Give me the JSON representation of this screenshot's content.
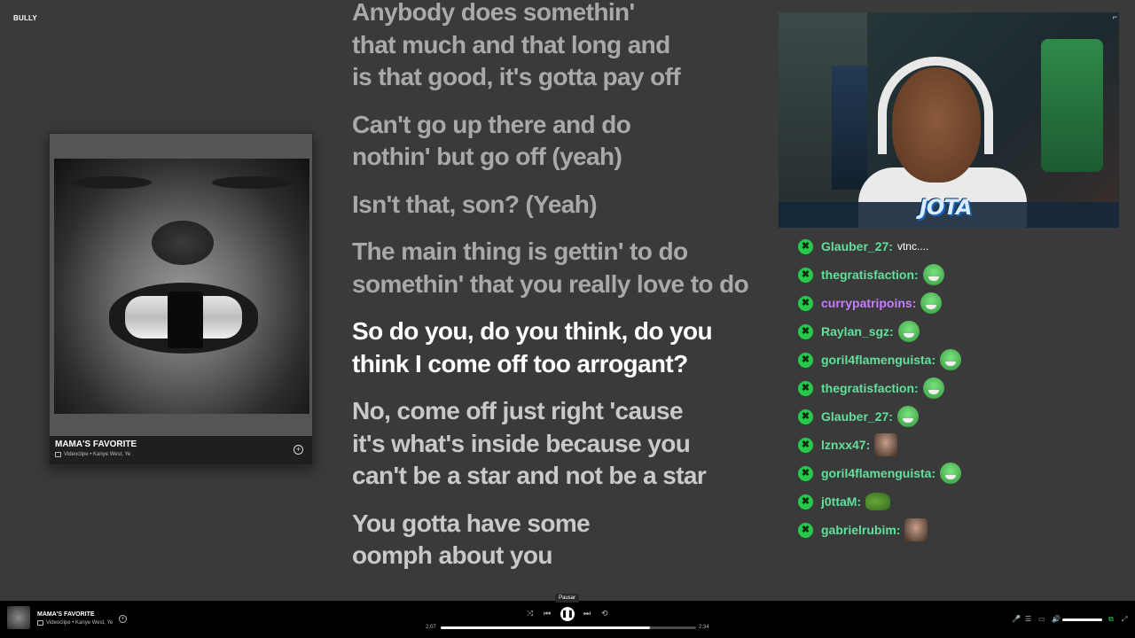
{
  "top_title": "BULLY",
  "album_card": {
    "song": "MAMA'S FAVORITE",
    "subtitle": "Videoclipe • Kanye West, Ye",
    "add_symbol": "+"
  },
  "lyrics": [
    {
      "text": "Anybody does somethin'\nthat much and that long and\nis that good, it's gotta pay off",
      "state": "past"
    },
    {
      "text": "Can't go up there and do\nnothin' but go off (yeah)",
      "state": "past"
    },
    {
      "text": "Isn't that, son? (Yeah)",
      "state": "past"
    },
    {
      "text": "The main thing is gettin' to do\nsomethin' that you really love to do",
      "state": "past"
    },
    {
      "text": "So do you, do you think, do you\nthink I come off too arrogant?",
      "state": "current"
    },
    {
      "text": "No, come off just right 'cause\nit's what's inside because you\ncan't be a star and not be a star",
      "state": "future"
    },
    {
      "text": "You gotta have some\noomph about you",
      "state": "future"
    }
  ],
  "webcam": {
    "logo": "JOTA",
    "corner_glyph": "⌐"
  },
  "chat": {
    "badge_glyph": "✖",
    "messages": [
      {
        "user": "Glauber_27:",
        "color": "#63e09a",
        "text": "vtnc....",
        "emote": ""
      },
      {
        "user": "thegratisfaction:",
        "color": "#63e09a",
        "text": "",
        "emote": "green"
      },
      {
        "user": "currypatripoins:",
        "color": "#c77dff",
        "text": "",
        "emote": "green"
      },
      {
        "user": "Raylan_sgz:",
        "color": "#63e09a",
        "text": "",
        "emote": "green"
      },
      {
        "user": "goril4flamenguista:",
        "color": "#63e09a",
        "text": "",
        "emote": "green"
      },
      {
        "user": "thegratisfaction:",
        "color": "#63e09a",
        "text": "",
        "emote": "green"
      },
      {
        "user": "Glauber_27:",
        "color": "#63e09a",
        "text": "",
        "emote": "green"
      },
      {
        "user": "lznxx47:",
        "color": "#63e09a",
        "text": "",
        "emote": "face"
      },
      {
        "user": "goril4flamenguista:",
        "color": "#63e09a",
        "text": "",
        "emote": "green"
      },
      {
        "user": "j0ttaM:",
        "color": "#63e09a",
        "text": "",
        "emote": "frog"
      },
      {
        "user": "gabrielrubim:",
        "color": "#63e09a",
        "text": "",
        "emote": "face"
      }
    ]
  },
  "player": {
    "song": "MAMA'S FAVORITE",
    "subtitle": "Videoclipe • Kanye West, Ye",
    "add_symbol": "+",
    "tooltip": "Pausar",
    "elapsed": "2:07",
    "duration": "2:34",
    "progress": 0.82,
    "shuffle_glyph": "⤨",
    "prev_glyph": "⏮",
    "play_glyph": "❚❚",
    "next_glyph": "⏭",
    "repeat_glyph": "⟲",
    "mic_glyph": "🎤",
    "queue_glyph": "☰",
    "device_glyph": "▭",
    "volume_glyph": "🔊",
    "miniplayer_glyph": "⧉",
    "fullscreen_glyph": "⤢"
  }
}
